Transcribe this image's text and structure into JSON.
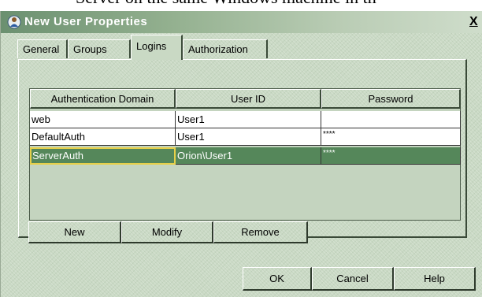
{
  "document": {
    "background_text": "Server on the same Windows machine in th"
  },
  "window": {
    "title": "New User Properties",
    "close_label": "X"
  },
  "tabs": [
    "General",
    "Groups",
    "Logins",
    "Authorization"
  ],
  "active_tab": "Logins",
  "table": {
    "columns": [
      "Authentication Domain",
      "User ID",
      "Password"
    ],
    "rows": [
      {
        "domain": "web",
        "user_id": "User1",
        "password": ""
      },
      {
        "domain": "DefaultAuth",
        "user_id": "User1",
        "password": "****"
      },
      {
        "domain": "ServerAuth",
        "user_id": "Orion\\User1",
        "password": "****"
      }
    ],
    "selected_row": 2
  },
  "row_buttons": {
    "new": "New",
    "modify": "Modify",
    "remove": "Remove"
  },
  "dialog_buttons": {
    "ok": "OK",
    "cancel": "Cancel",
    "help": "Help"
  },
  "colors": {
    "selection": "#55875a",
    "focus_border": "#e6d04a",
    "dialog_background": "#c9d9c4"
  }
}
